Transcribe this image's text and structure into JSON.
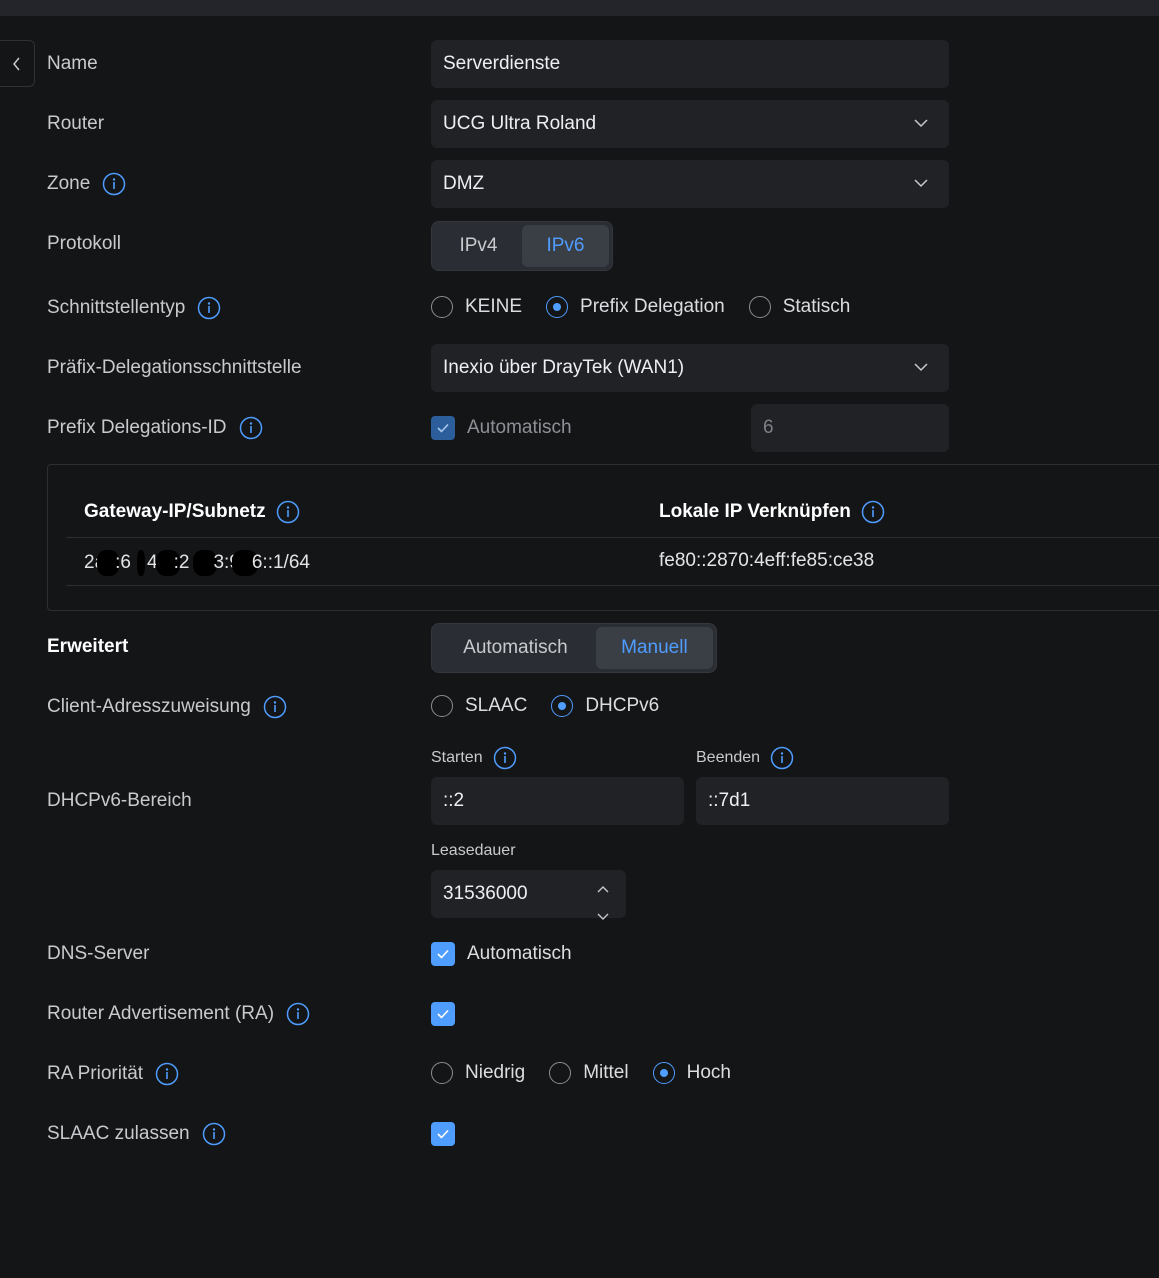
{
  "form": {
    "name_label": "Name",
    "name_value": "Serverdienste",
    "router_label": "Router",
    "router_value": "UCG Ultra Roland",
    "zone_label": "Zone",
    "zone_value": "DMZ",
    "protocol_label": "Protokoll",
    "protocol_options": [
      "IPv4",
      "IPv6"
    ],
    "protocol_selected": "IPv6",
    "interface_type_label": "Schnittstellentyp",
    "interface_type_options": [
      "KEINE",
      "Prefix Delegation",
      "Statisch"
    ],
    "interface_type_selected": "Prefix Delegation",
    "pd_interface_label": "Präfix-Delegationsschnittstelle",
    "pd_interface_value": "Inexio über DrayTek (WAN1)",
    "pd_id_label": "Prefix Delegations-ID",
    "pd_id_auto_label": "Automatisch",
    "pd_id_auto_checked": true,
    "pd_id_value": "6"
  },
  "table": {
    "headers": [
      "Gateway-IP/Subnetz",
      "Lokale IP Verknüpfen"
    ],
    "row": {
      "gateway_parts": [
        "2a",
        ":6",
        "4",
        ":2",
        "3:9",
        "6::1/64"
      ],
      "link_local": "fe80::2870:4eff:fe85:ce38"
    }
  },
  "advanced": {
    "label": "Erweitert",
    "mode_options": [
      "Automatisch",
      "Manuell"
    ],
    "mode_selected": "Manuell",
    "client_assign_label": "Client-Adresszuweisung",
    "client_assign_options": [
      "SLAAC",
      "DHCPv6"
    ],
    "client_assign_selected": "DHCPv6",
    "dhcp_range_label": "DHCPv6-Bereich",
    "start_label": "Starten",
    "start_value": "::2",
    "end_label": "Beenden",
    "end_value": "::7d1",
    "lease_label": "Leasedauer",
    "lease_value": "31536000",
    "dns_label": "DNS-Server",
    "dns_auto_label": "Automatisch",
    "dns_auto_checked": true,
    "ra_label": "Router Advertisement (RA)",
    "ra_checked": true,
    "ra_priority_label": "RA Priorität",
    "ra_priority_options": [
      "Niedrig",
      "Mittel",
      "Hoch"
    ],
    "ra_priority_selected": "Hoch",
    "slaac_allow_label": "SLAAC zulassen",
    "slaac_allow_checked": true
  },
  "colors": {
    "accent": "#4f9dff",
    "background": "#141517",
    "field": "#202226"
  },
  "icons": [
    "back-arrow-icon",
    "info-icon",
    "chevron-down-icon",
    "check-icon",
    "stepper-up-icon",
    "stepper-down-icon"
  ]
}
